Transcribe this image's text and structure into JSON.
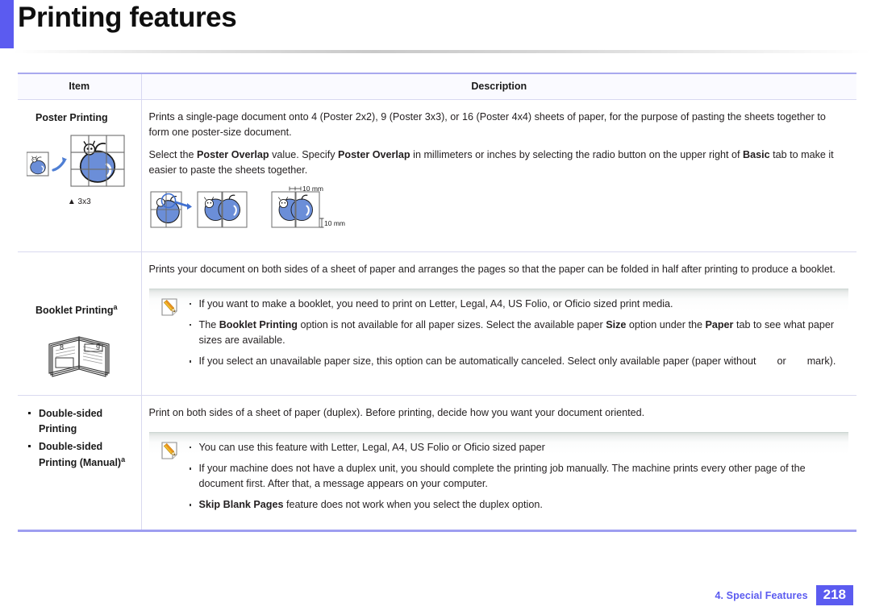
{
  "header": {
    "title": "Printing features",
    "accent_color": "#5b5bf0"
  },
  "table": {
    "columns": [
      "Item",
      "Description"
    ],
    "rows": [
      {
        "item": {
          "label": "Poster Printing",
          "superscript": "",
          "figure": "poster-printing-3x3-illustration",
          "figure_caption": "3x3"
        },
        "description_paragraphs": [
          "Prints a single-page document onto 4 (Poster 2x2), 9 (Poster 3x3), or 16 (Poster 4x4) sheets of paper, for the purpose of pasting the sheets together to form one poster-size document.",
          "Select the Poster Overlap value. Specify Poster Overlap in millimeters or inches by selecting the radio button on the upper right of Basic tab to make it easier to paste the sheets together."
        ],
        "figure_inline": "poster-overlap-10mm-illustration",
        "figure_inline_labels": [
          "10 mm",
          "10 mm"
        ]
      },
      {
        "item": {
          "label": "Booklet Printing",
          "superscript": "a",
          "figure": "booklet-open-book-illustration",
          "figure_page_numbers": [
            "8",
            "9"
          ]
        },
        "description_paragraphs": [
          "Prints your document on both sides of a sheet of paper and arranges the pages so that the paper can be folded in half after printing to produce a booklet."
        ],
        "note": {
          "icon": "note-pencil-icon",
          "bullets": [
            "If you want to make a booklet, you need to print on Letter, Legal, A4, US Folio, or Oficio sized print media.",
            "The Booklet Printing option is not available for all paper sizes. Select the available paper Size option under the Paper tab to see what paper sizes are available.",
            "If you select an unavailable paper size, this option can be automatically canceled. Select only available paper (paper without  or  mark)."
          ]
        }
      },
      {
        "item": {
          "bullets": [
            {
              "label": "Double-sided Printing",
              "superscript": ""
            },
            {
              "label": "Double-sided Printing (Manual)",
              "superscript": "a"
            }
          ]
        },
        "description_paragraphs": [
          "Print on both sides of a sheet of paper (duplex). Before printing, decide how you want your document oriented."
        ],
        "note": {
          "icon": "note-pencil-icon",
          "bullets": [
            "You can use this feature with Letter, Legal, A4, US Folio or Oficio sized paper",
            "If your machine does not have a duplex unit, you should complete the printing job manually. The machine prints every other page of the document first. After that, a message appears on your computer.",
            "Skip Blank Pages feature does not work when you select the duplex option."
          ]
        }
      }
    ]
  },
  "footer": {
    "chapter": "4.  Special Features",
    "page_number": "218",
    "color": "#5b5bf0"
  }
}
